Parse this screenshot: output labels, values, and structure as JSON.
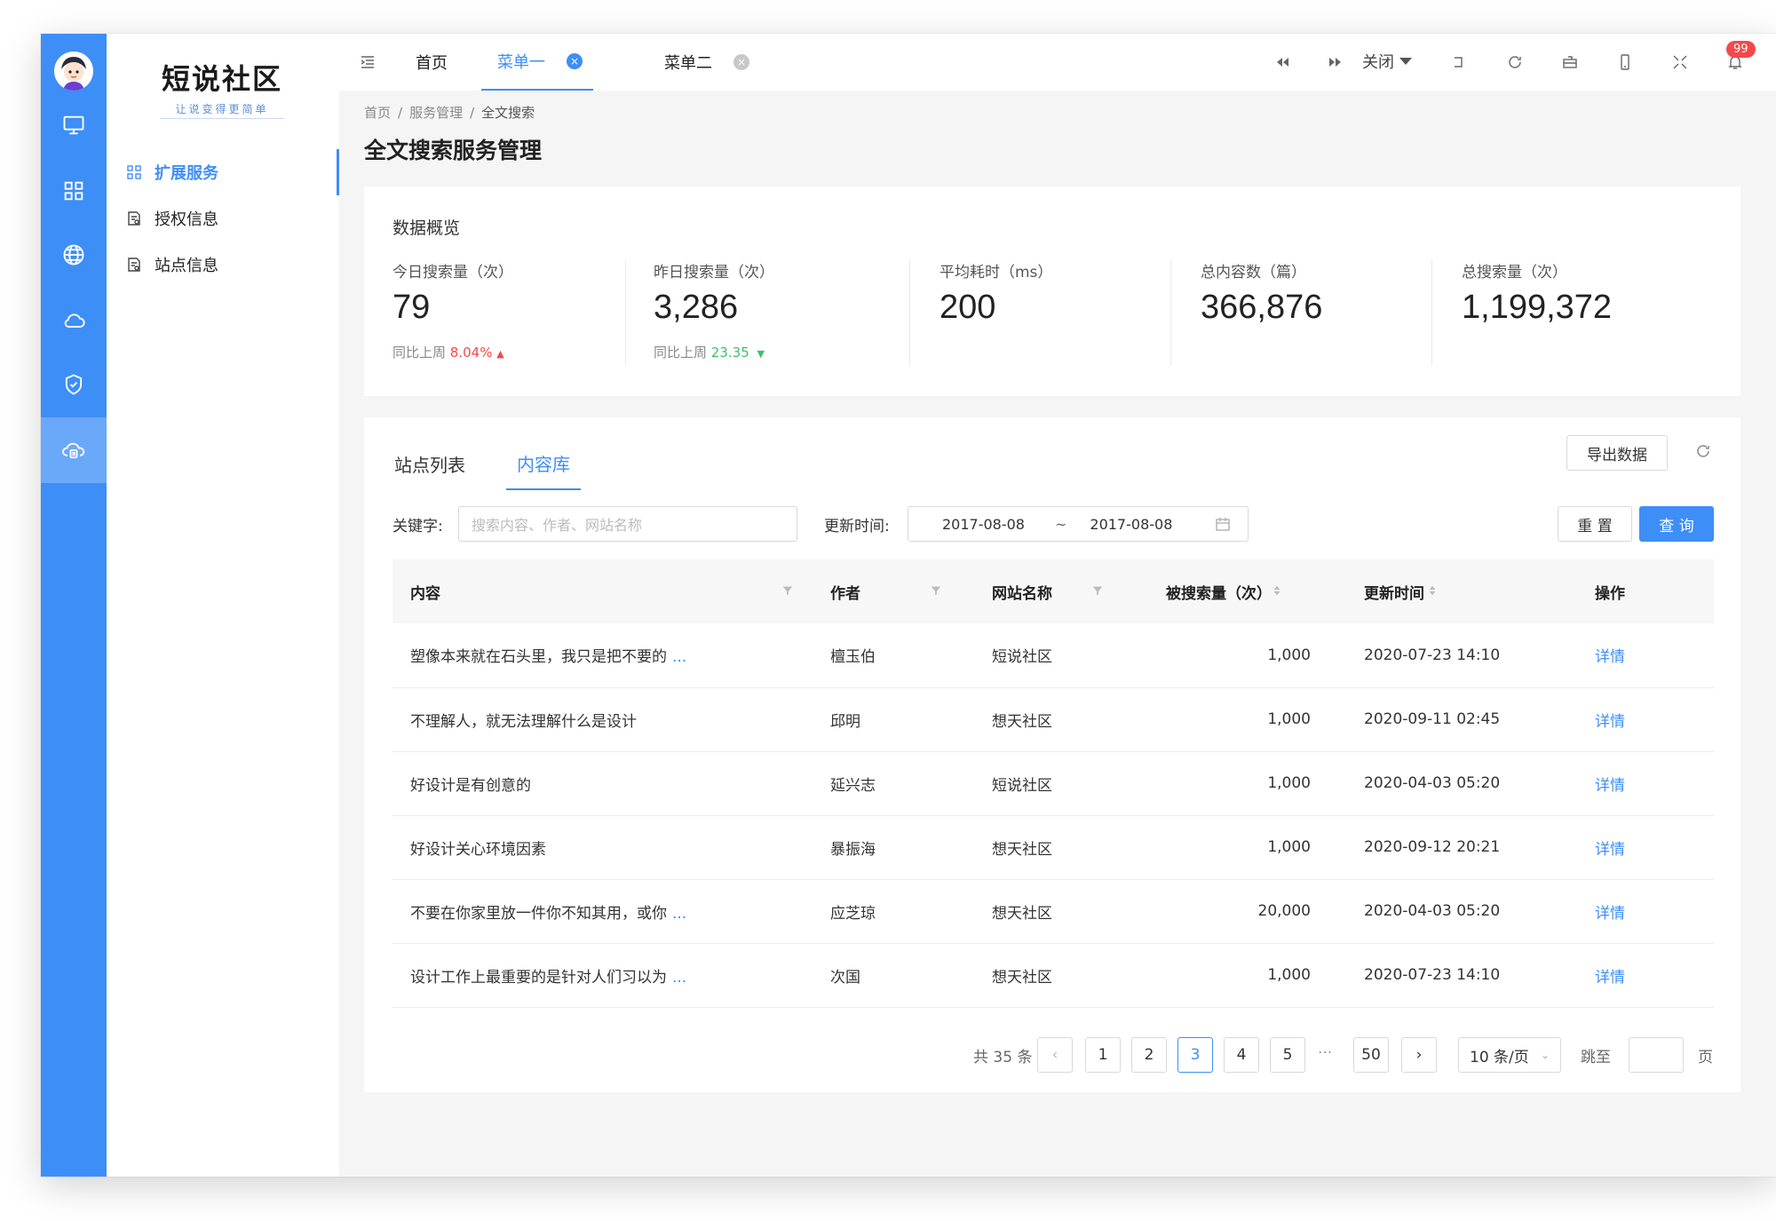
{
  "brand": {
    "title": "短说社区",
    "subtitle": "让说变得更简单"
  },
  "rail": {
    "icons": [
      "monitor-icon",
      "grid-icon",
      "globe-icon",
      "cloud-icon",
      "shield-check-icon",
      "cloud-search-icon"
    ],
    "active_index": 5
  },
  "submenu": [
    {
      "label": "扩展服务",
      "icon": "apps-icon",
      "active": true
    },
    {
      "label": "授权信息",
      "icon": "document-icon",
      "active": false
    },
    {
      "label": "站点信息",
      "icon": "document-icon",
      "active": false
    }
  ],
  "topbar": {
    "tabs": [
      {
        "label": "首页"
      },
      {
        "label": "菜单一",
        "active": true
      },
      {
        "label": "菜单二"
      }
    ],
    "close_label": "关闭",
    "notification_count": "99"
  },
  "breadcrumb": [
    "首页",
    "服务管理",
    "全文搜索"
  ],
  "page_title": "全文搜索服务管理",
  "overview": {
    "title": "数据概览",
    "stats": [
      {
        "label": "今日搜索量（次）",
        "value": "79",
        "cmp_label": "同比上周",
        "cmp_value": "8.04%",
        "trend": "up"
      },
      {
        "label": "昨日搜索量（次）",
        "value": "3,286",
        "cmp_label": "同比上周",
        "cmp_value": "23.35",
        "trend": "down"
      },
      {
        "label": "平均耗时（ms）",
        "value": "200"
      },
      {
        "label": "总内容数（篇）",
        "value": "366,876"
      },
      {
        "label": "总搜索量（次）",
        "value": "1,199,372"
      }
    ]
  },
  "content": {
    "tabs": [
      "站点列表",
      "内容库"
    ],
    "active_tab": 1,
    "export_label": "导出数据",
    "filters": {
      "keyword_label": "关键字:",
      "keyword_placeholder": "搜索内容、作者、网站名称",
      "time_label": "更新时间:",
      "date_from": "2017-08-08",
      "date_sep": "~",
      "date_to": "2017-08-08",
      "reset_label": "重 置",
      "query_label": "查 询"
    },
    "columns": [
      "内容",
      "作者",
      "网站名称",
      "被搜索量（次）",
      "更新时间",
      "操作"
    ],
    "rows": [
      {
        "content": "塑像本来就在石头里，我只是把不要的",
        "truncated": true,
        "author": "檀玉伯",
        "site": "短说社区",
        "count": "1,000",
        "time": "2020-07-23 14:10",
        "action": "详情"
      },
      {
        "content": "不理解人，就无法理解什么是设计",
        "truncated": false,
        "author": "邱明",
        "site": "想天社区",
        "count": "1,000",
        "time": "2020-09-11 02:45",
        "action": "详情"
      },
      {
        "content": "好设计是有创意的",
        "truncated": false,
        "author": "延兴志",
        "site": "短说社区",
        "count": "1,000",
        "time": "2020-04-03 05:20",
        "action": "详情"
      },
      {
        "content": "好设计关心环境因素",
        "truncated": false,
        "author": "暴振海",
        "site": "想天社区",
        "count": "1,000",
        "time": "2020-09-12 20:21",
        "action": "详情"
      },
      {
        "content": "不要在你家里放一件你不知其用，或你",
        "truncated": true,
        "author": "应芝琼",
        "site": "想天社区",
        "count": "20,000",
        "time": "2020-04-03 05:20",
        "action": "详情"
      },
      {
        "content": "设计工作上最重要的是针对人们习以为",
        "truncated": true,
        "author": "次国",
        "site": "想天社区",
        "count": "1,000",
        "time": "2020-07-23 14:10",
        "action": "详情"
      }
    ],
    "ellipsis": "...",
    "pagination": {
      "total_text": "共 35 条",
      "pages": [
        "1",
        "2",
        "3",
        "4",
        "5"
      ],
      "current": "3",
      "more": "···",
      "last": "50",
      "page_size": "10 条/页",
      "jump_label": "跳至",
      "page_unit": "页"
    }
  },
  "colors": {
    "primary": "#3e8ef7",
    "up": "#f5484a",
    "down": "#3fc06a"
  }
}
